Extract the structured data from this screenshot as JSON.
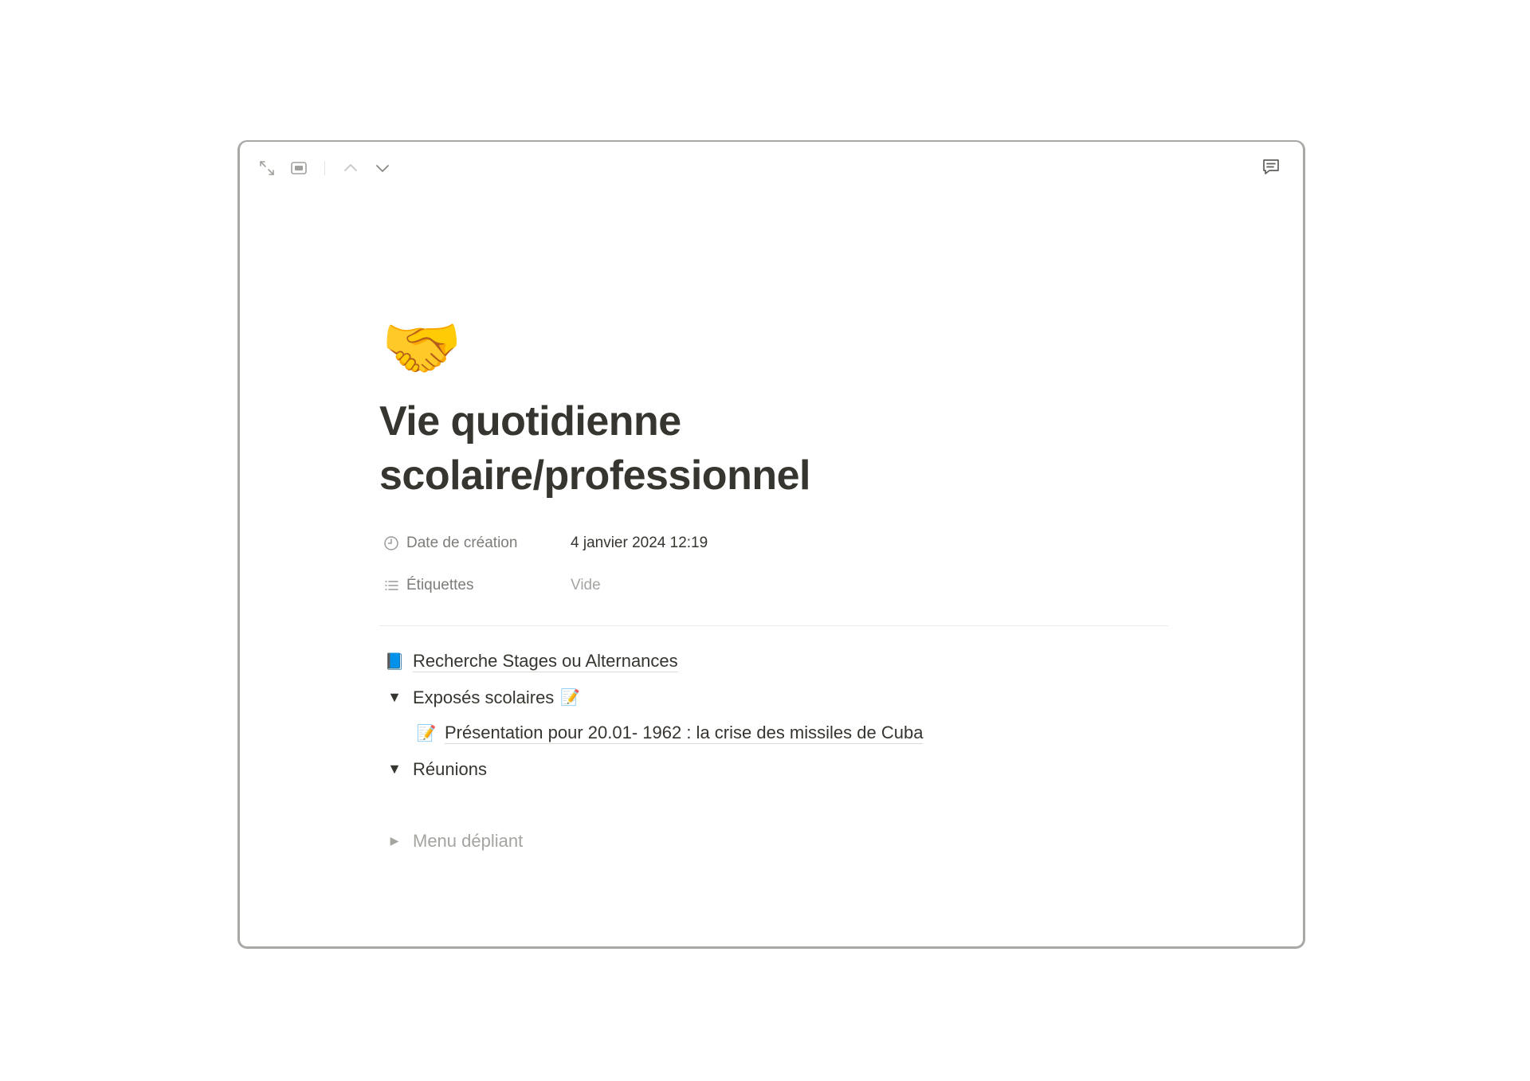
{
  "toolbar": {
    "icons": [
      "expand-icon",
      "peek-mode-icon",
      "chevron-up-icon",
      "chevron-down-icon"
    ],
    "comment_icon": "comment-icon"
  },
  "page": {
    "icon": "🤝",
    "title": "Vie quotidienne scolaire/professionnel"
  },
  "properties": [
    {
      "icon": "clock-icon",
      "name": "Date de création",
      "value": "4 janvier 2024 12:19",
      "empty": false
    },
    {
      "icon": "list-icon",
      "name": "Étiquettes",
      "value": "Vide",
      "empty": true
    }
  ],
  "blocks": {
    "link1": {
      "emoji": "📘",
      "text": "Recherche Stages ou Alternances"
    },
    "toggle1": {
      "arrow": "▼",
      "text": "Exposés scolaires",
      "emoji": "📝"
    },
    "toggle1_child": {
      "emoji": "📝",
      "text": "Présentation pour 20.01- 1962 : la crise des missiles de Cuba"
    },
    "toggle2": {
      "arrow": "▼",
      "text": "Réunions"
    },
    "toggle3": {
      "arrow": "▶",
      "text": "Menu dépliant"
    }
  },
  "colors": {
    "text": "#37352f",
    "muted": "#a5a4a0",
    "property_label": "#7d7c78"
  }
}
